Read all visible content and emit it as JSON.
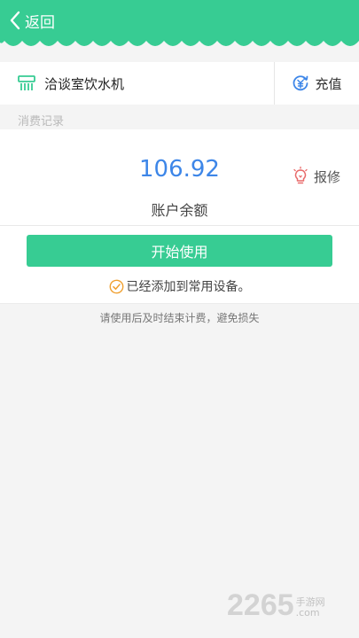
{
  "header": {
    "back_label": "返回"
  },
  "device": {
    "name": "洽谈室饮水机",
    "recharge_label": "充值"
  },
  "records_label": "消费记录",
  "account": {
    "balance": "106.92",
    "balance_label": "账户余额",
    "repair_label": "报修"
  },
  "actions": {
    "start_label": "开始使用",
    "added_label": "已经添加到常用设备。"
  },
  "notice": "请使用后及时结束计费，避免损失",
  "watermark": {
    "number": "2265",
    "cn": "手游网",
    "dot_com": ".com"
  },
  "colors": {
    "accent": "#37cc93",
    "balance": "#3d86e8",
    "repair_icon": "#e86a6a",
    "check": "#f0a030"
  },
  "icons": {
    "back": "chevron-left-icon",
    "device": "water-dispenser-icon",
    "recharge": "recharge-icon",
    "repair": "lightbulb-icon",
    "added": "check-circle-icon"
  }
}
